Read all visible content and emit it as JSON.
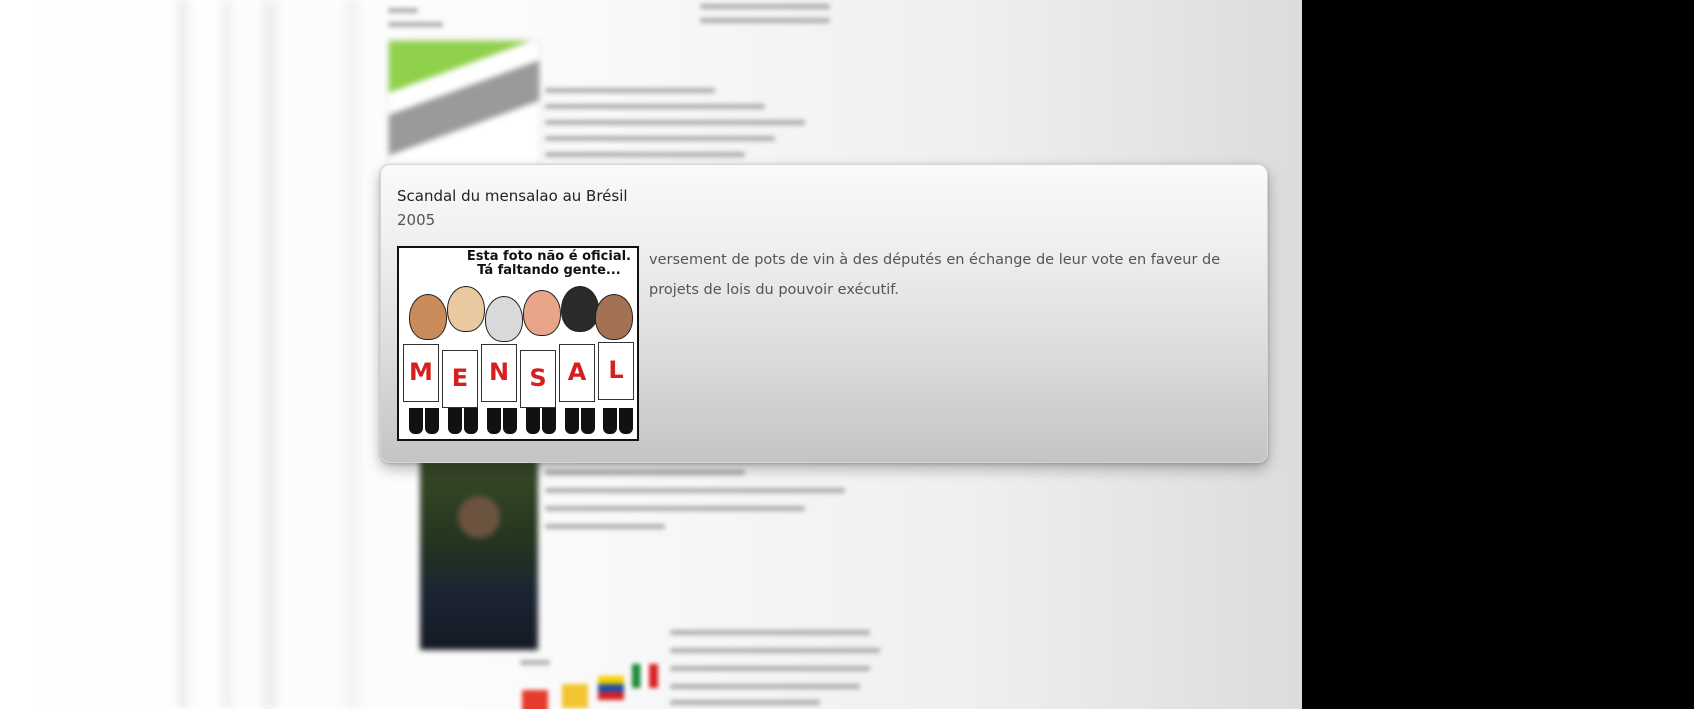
{
  "popup": {
    "title": "Scandal du mensalao au Brésil",
    "year": "2005",
    "description": "versement de pots de vin à des députés en échange de leur vote en faveur de projets de lois du pouvoir exécutif.",
    "image": {
      "caption_line1": "Esta foto não é oficial.",
      "caption_line2": "Tá faltando gente...",
      "sign_letters": [
        "M",
        "E",
        "N",
        "S",
        "A",
        "L"
      ]
    }
  },
  "colors": {
    "popup_text": "#555555",
    "sign_letter": "#d62020",
    "map_highlight": "#8fd14b",
    "outside_area": "#000000"
  }
}
